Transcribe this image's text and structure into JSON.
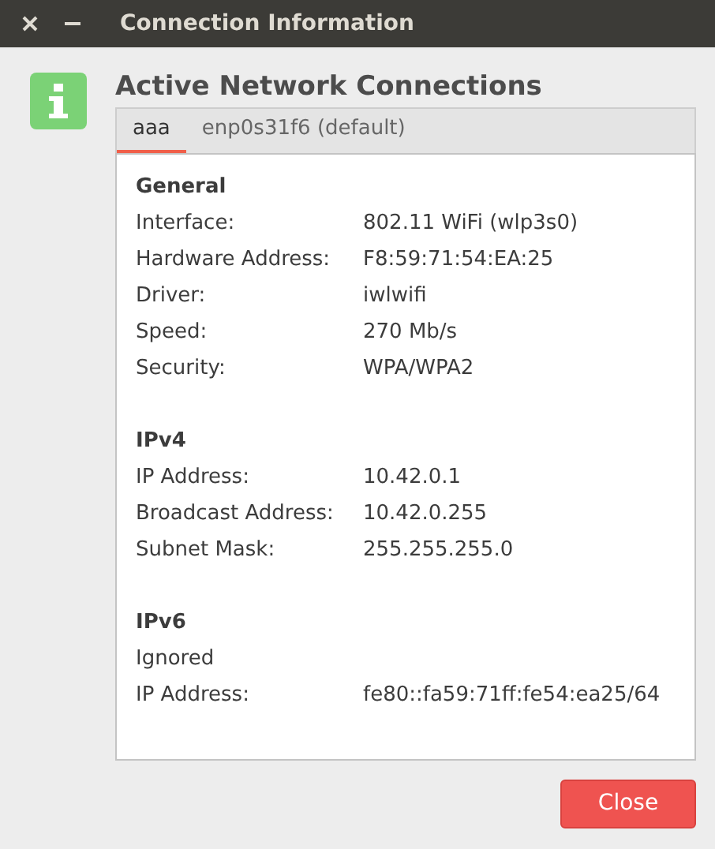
{
  "window": {
    "title": "Connection Information"
  },
  "heading": "Active Network Connections",
  "tabs": [
    {
      "label": "aaa",
      "selected": true
    },
    {
      "label": "enp0s31f6 (default)",
      "selected": false
    }
  ],
  "sections": [
    {
      "title": "General",
      "rows": [
        {
          "label": "Interface:",
          "value": "802.11 WiFi (wlp3s0)"
        },
        {
          "label": "Hardware Address:",
          "value": "F8:59:71:54:EA:25"
        },
        {
          "label": "Driver:",
          "value": "iwlwifi"
        },
        {
          "label": "Speed:",
          "value": "270 Mb/s"
        },
        {
          "label": "Security:",
          "value": "WPA/WPA2"
        }
      ]
    },
    {
      "title": "IPv4",
      "rows": [
        {
          "label": "IP Address:",
          "value": "10.42.0.1"
        },
        {
          "label": "Broadcast Address:",
          "value": "10.42.0.255"
        },
        {
          "label": "Subnet Mask:",
          "value": "255.255.255.0"
        }
      ]
    },
    {
      "title": "IPv6",
      "rows": [
        {
          "label": "Ignored"
        },
        {
          "label": "IP Address:",
          "value": "fe80::fa59:71ff:fe54:ea25/64"
        }
      ]
    }
  ],
  "buttons": [
    "Close"
  ]
}
